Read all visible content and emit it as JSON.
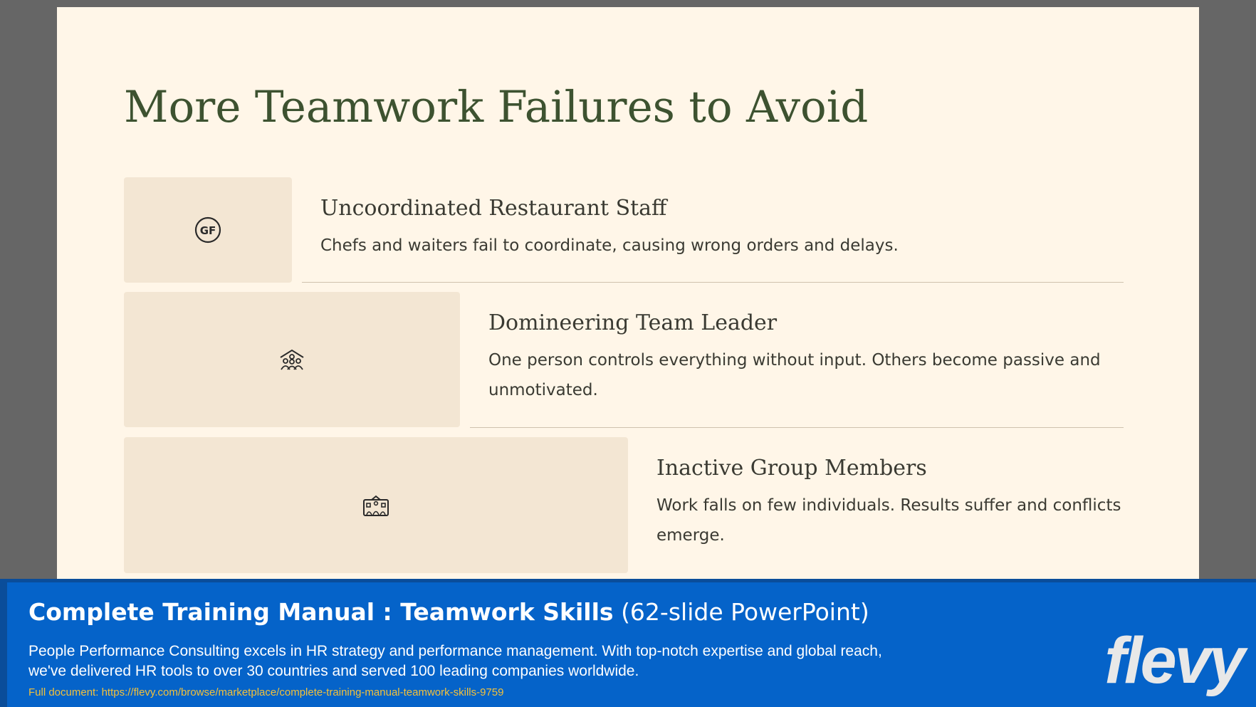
{
  "slide": {
    "title": "More Teamwork Failures to Avoid",
    "items": [
      {
        "heading": "Uncoordinated Restaurant Staff",
        "description": "Chefs and waiters fail to coordinate, causing wrong orders and delays.",
        "icon": "gf-badge-icon"
      },
      {
        "heading": "Domineering Team Leader",
        "description": "One person controls everything without input. Others become passive and unmotivated.",
        "icon": "team-group-icon"
      },
      {
        "heading": "Inactive Group Members",
        "description": "Work falls on few individuals. Results suffer and conflicts emerge.",
        "icon": "office-building-icon"
      }
    ]
  },
  "banner": {
    "title_bold": "Complete Training Manual : Teamwork Skills",
    "title_light": "(62-slide PowerPoint)",
    "description": "People Performance Consulting excels in HR strategy and performance management. With top-notch expertise and global reach, we've delivered HR tools to over 30 countries and served 100 leading companies worldwide.",
    "link_label": "Full document:",
    "link_url": "https://flevy.com/browse/marketplace/complete-training-manual-teamwork-skills-9759",
    "logo_text": "flevy"
  },
  "colors": {
    "slide_background": "#fff6e8",
    "title_green": "#3d5230",
    "icon_box": "#f3e6d3",
    "banner_blue": "#0563c9",
    "link_yellow": "#f3c13a"
  }
}
